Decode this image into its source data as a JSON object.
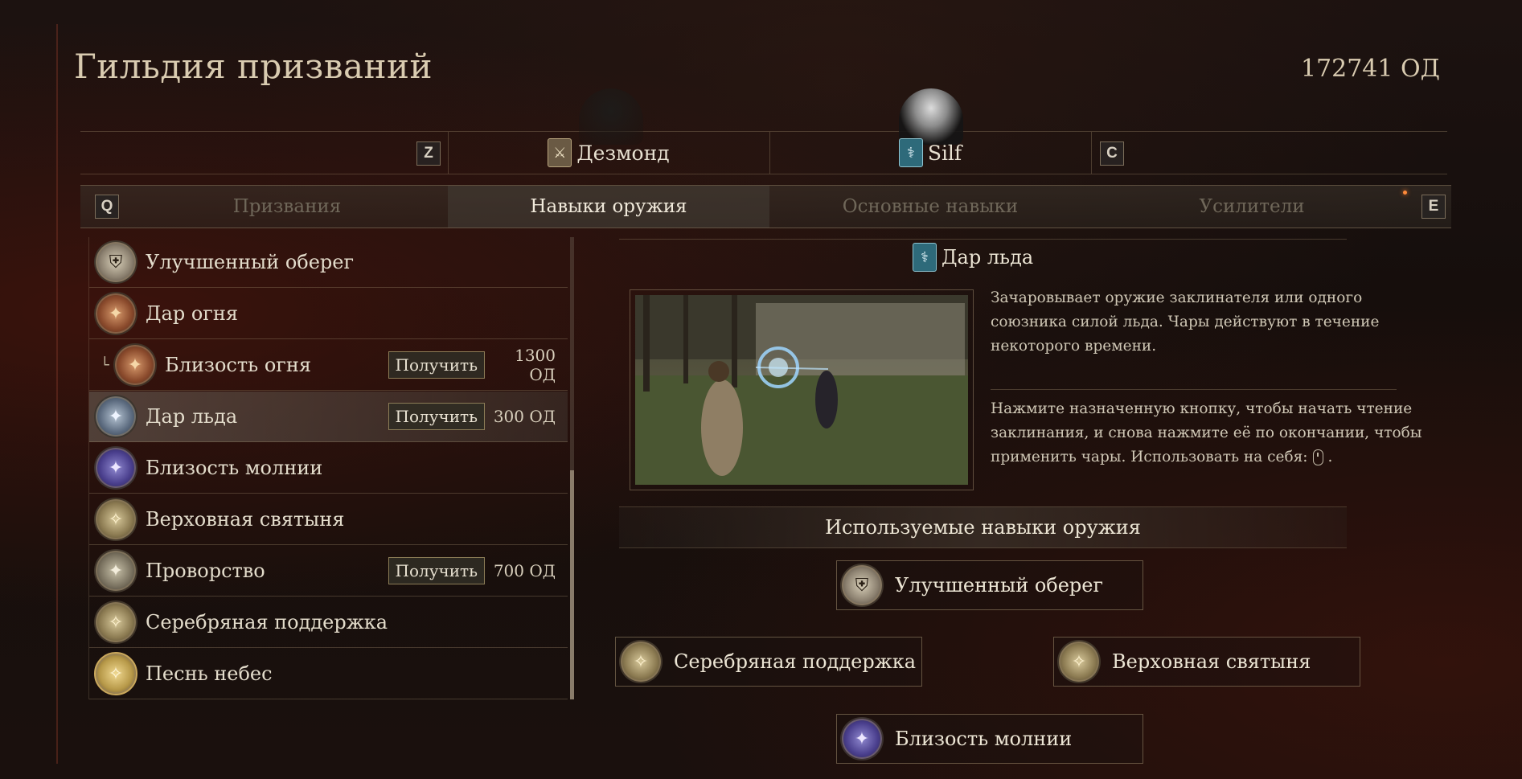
{
  "header": {
    "title": "Гильдия призваний",
    "currency": "172741 ОД"
  },
  "characters": {
    "prev_key": "Z",
    "next_key": "C",
    "items": [
      {
        "name": "Дезмонд",
        "icon": "fighter-vocation-icon"
      },
      {
        "name": "Silf",
        "icon": "mage-vocation-icon"
      }
    ]
  },
  "tabs": {
    "prev_key": "Q",
    "next_key": "E",
    "items": [
      {
        "label": "Призвания",
        "active": false
      },
      {
        "label": "Навыки оружия",
        "active": true
      },
      {
        "label": "Основные навыки",
        "active": false
      },
      {
        "label": "Усилители",
        "active": false
      }
    ]
  },
  "skills": [
    {
      "label": "Улучшенный оберег",
      "icon": "ward-shield-icon",
      "get_label": "",
      "cost": ""
    },
    {
      "label": "Дар огня",
      "icon": "fire-boon-icon",
      "get_label": "",
      "cost": ""
    },
    {
      "label": "Близость огня",
      "icon": "fire-affinity-icon",
      "get_label": "Получить",
      "cost": "1300 ОД"
    },
    {
      "label": "Дар льда",
      "icon": "ice-boon-icon",
      "get_label": "Получить",
      "cost": "300 ОД"
    },
    {
      "label": "Близость молнии",
      "icon": "lightning-affinity-icon",
      "get_label": "",
      "cost": ""
    },
    {
      "label": "Верховная святыня",
      "icon": "holy-sanctuary-icon",
      "get_label": "",
      "cost": ""
    },
    {
      "label": "Проворство",
      "icon": "agility-icon",
      "get_label": "Получить",
      "cost": "700 ОД"
    },
    {
      "label": "Серебряная поддержка",
      "icon": "silver-support-icon",
      "get_label": "",
      "cost": ""
    },
    {
      "label": "Песнь небес",
      "icon": "heaven-song-icon",
      "get_label": "",
      "cost": ""
    }
  ],
  "detail": {
    "title": "Дар льда",
    "description": "Зачаровывает оружие заклинателя или одного союзника силой льда. Чары действуют в течение некоторого времени.",
    "instructions": "Нажмите назначенную кнопку, чтобы начать чтение заклинания, и снова нажмите её по окончании, чтобы применить чары. Использовать на себя:",
    "instructions_end": "."
  },
  "equipped": {
    "title": "Используемые навыки оружия",
    "slots": [
      {
        "label": "Улучшенный оберег",
        "icon": "ward-shield-icon"
      },
      {
        "label": "Серебряная поддержка",
        "icon": "silver-support-icon"
      },
      {
        "label": "Верховная святыня",
        "icon": "holy-sanctuary-icon"
      },
      {
        "label": "Близость молнии",
        "icon": "lightning-affinity-icon"
      }
    ]
  }
}
